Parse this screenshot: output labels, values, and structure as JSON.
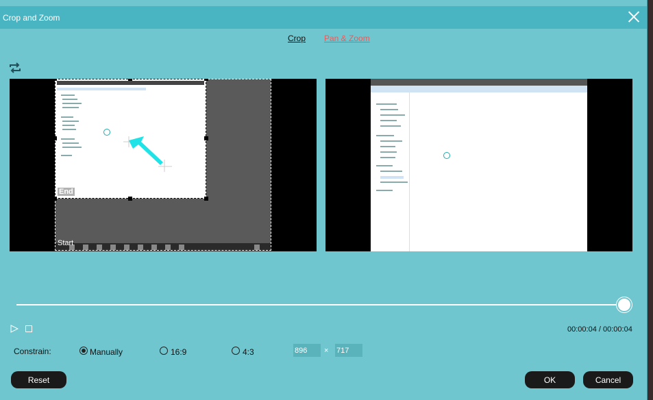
{
  "window": {
    "title": "Crop and Zoom"
  },
  "tabs": [
    {
      "label": "Crop"
    },
    {
      "label": "Pan & Zoom"
    }
  ],
  "preview": {
    "end_label": "End",
    "start_label": "Start"
  },
  "playback": {
    "time": "00:00:04 / 00:00:04",
    "progress": 1.0
  },
  "constrain": {
    "label": "Constrain:",
    "options": [
      {
        "label": "Manually",
        "selected": true
      },
      {
        "label": "16:9",
        "selected": false
      },
      {
        "label": "4:3",
        "selected": false
      }
    ],
    "width": "896",
    "height": "717",
    "times": "×"
  },
  "buttons": {
    "reset": "Reset",
    "ok": "OK",
    "cancel": "Cancel"
  },
  "icons": {
    "repeat": "repeat-icon",
    "close": "close-icon",
    "play": "play-icon",
    "stop": "stop-icon"
  },
  "colors": {
    "accent": "#4ab5c2",
    "background": "#6fc6cf",
    "link": "#e06060"
  }
}
